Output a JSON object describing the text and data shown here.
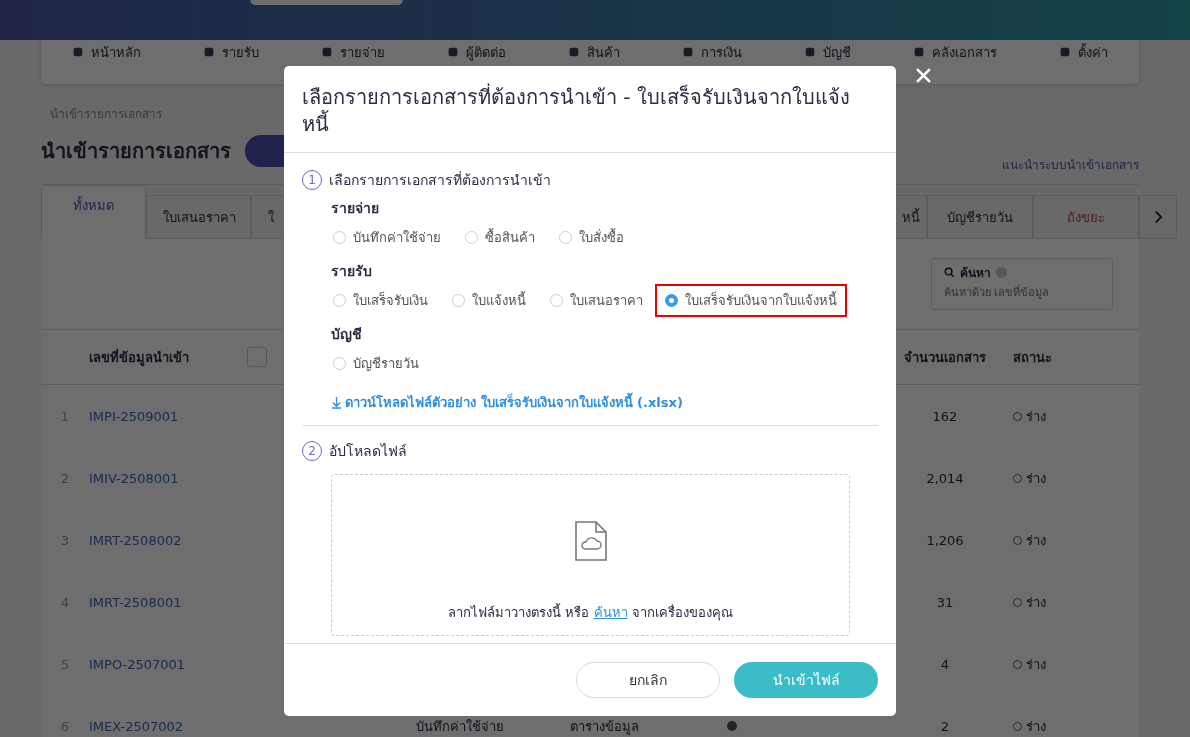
{
  "nav": [
    {
      "label": "หน้าหลัก"
    },
    {
      "label": "รายรับ"
    },
    {
      "label": "รายจ่าย"
    },
    {
      "label": "ผู้ติดต่อ"
    },
    {
      "label": "สินค้า"
    },
    {
      "label": "การเงิน"
    },
    {
      "label": "บัญชี"
    },
    {
      "label": "คลังเอกสาร"
    },
    {
      "label": "ตั้งค่า"
    }
  ],
  "breadcrumb": "นำเข้ารายการเอกสาร",
  "page_title": "นำเข้ารายการเอกสาร",
  "guide_link": "แนะนำระบบนำเข้าเอกสาร",
  "tabs_left": [
    {
      "label": "ทั้งหมด",
      "selected": true,
      "kind": "normal"
    },
    {
      "label": "ใบเสนอราคา",
      "selected": false,
      "kind": "normal"
    },
    {
      "label": "ใ",
      "selected": false,
      "kind": "normal"
    }
  ],
  "tabs_right": [
    {
      "label": "หนี้",
      "selected": false,
      "kind": "normal"
    },
    {
      "label": "บัญชีรายวัน",
      "selected": false,
      "kind": "normal"
    },
    {
      "label": "ถังขยะ",
      "selected": false,
      "kind": "trash"
    }
  ],
  "search": {
    "label": "ค้นหา",
    "placeholder": "ค้นหาด้วย เลขที่ข้อมูล"
  },
  "table": {
    "columns": {
      "id": "เลขที่ข้อมูลนำเข้า",
      "count": "จำนวนเอกสาร",
      "status": "สถานะ"
    },
    "rows": [
      {
        "no": "1",
        "id": "IMPI-2509001",
        "count": "162",
        "status": "ร่าง"
      },
      {
        "no": "2",
        "id": "IMIV-2508001",
        "count": "2,014",
        "status": "ร่าง"
      },
      {
        "no": "3",
        "id": "IMRT-2508002",
        "count": "1,206",
        "status": "ร่าง"
      },
      {
        "no": "4",
        "id": "IMRT-2508001",
        "count": "31",
        "status": "ร่าง"
      },
      {
        "no": "5",
        "id": "IMPO-2507001",
        "count": "4",
        "status": "ร่าง"
      },
      {
        "no": "6",
        "id": "IMEX-2507002",
        "type": "บันทึกค่าใช้จ่าย",
        "format": "ตารางข้อมูล",
        "count": "2",
        "status": "ร่าง"
      }
    ]
  },
  "dialog": {
    "title": "เลือกรายการเอกสารที่ต้องการนำเข้า - ใบเสร็จรับเงินจากใบแจ้งหนี้",
    "step1": {
      "number": "1",
      "label": "เลือกรายการเอกสารที่ต้องการนำเข้า"
    },
    "groups": [
      {
        "label": "รายจ่าย",
        "options": [
          {
            "label": "บันทึกค่าใช้จ่าย",
            "selected": false,
            "highlighted": false
          },
          {
            "label": "ซื้อสินค้า",
            "selected": false,
            "highlighted": false
          },
          {
            "label": "ใบสั่งซื้อ",
            "selected": false,
            "highlighted": false
          }
        ]
      },
      {
        "label": "รายรับ",
        "options": [
          {
            "label": "ใบเสร็จรับเงิน",
            "selected": false,
            "highlighted": false
          },
          {
            "label": "ใบแจ้งหนี้",
            "selected": false,
            "highlighted": false
          },
          {
            "label": "ใบเสนอราคา",
            "selected": false,
            "highlighted": false
          },
          {
            "label": "ใบเสร็จรับเงินจากใบแจ้งหนี้",
            "selected": true,
            "highlighted": true
          }
        ]
      },
      {
        "label": "บัญชี",
        "options": [
          {
            "label": "บัญชีรายวัน",
            "selected": false,
            "highlighted": false
          }
        ]
      }
    ],
    "download_link": "ดาวน์โหลดไฟล์ตัวอย่าง ใบเสร็จรับเงินจากใบแจ้งหนี้ (.xlsx)",
    "step2": {
      "number": "2",
      "label": "อัปโหลดไฟล์"
    },
    "dropzone": {
      "before": "ลากไฟล์มาวางตรงนี้ หรือ",
      "link": "ค้นหา",
      "after": "จากเครื่องของคุณ"
    },
    "buttons": {
      "cancel": "ยกเลิก",
      "import": "นำเข้าไฟล์"
    }
  }
}
